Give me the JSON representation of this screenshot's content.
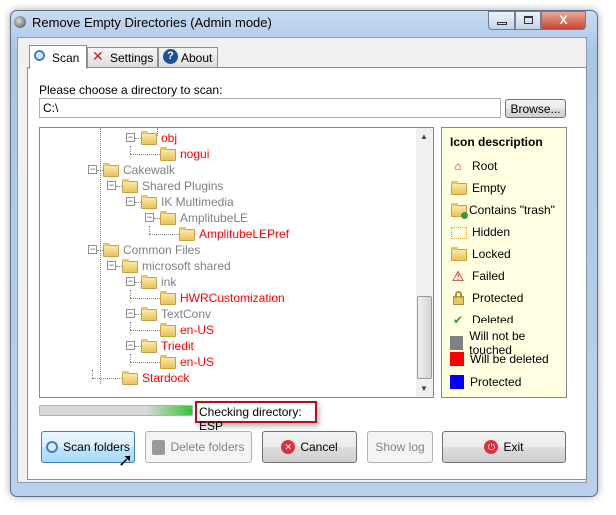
{
  "window": {
    "title": "Remove Empty Directories (Admin mode)",
    "close_label": "X"
  },
  "tabs": [
    {
      "label": "Scan",
      "icon": "magnifier-icon"
    },
    {
      "label": "Settings",
      "icon": "tools-icon"
    },
    {
      "label": "About",
      "icon": "help-icon"
    }
  ],
  "scan": {
    "prompt": "Please choose a directory to scan:",
    "directory": "C:\\",
    "browse_label": "Browse...",
    "status": "Checking directory: ESP",
    "progress_percent": 27
  },
  "tree": [
    {
      "label": "obj",
      "level": 2,
      "color": "red",
      "expanded": true
    },
    {
      "label": "nogui",
      "level": 3,
      "color": "red",
      "expanded": false
    },
    {
      "label": "Cakewalk",
      "level": 0,
      "color": "gray",
      "expanded": true
    },
    {
      "label": "Shared Plugins",
      "level": 1,
      "color": "gray",
      "expanded": true
    },
    {
      "label": "IK Multimedia",
      "level": 2,
      "color": "gray",
      "expanded": true
    },
    {
      "label": "AmplitubeLE",
      "level": 3,
      "color": "gray",
      "expanded": true
    },
    {
      "label": "AmplitubeLEPref",
      "level": 4,
      "color": "red",
      "expanded": false
    },
    {
      "label": "Common Files",
      "level": 0,
      "color": "gray",
      "expanded": true
    },
    {
      "label": "microsoft shared",
      "level": 1,
      "color": "gray",
      "expanded": true
    },
    {
      "label": "ink",
      "level": 2,
      "color": "gray",
      "expanded": true
    },
    {
      "label": "HWRCustomization",
      "level": 3,
      "color": "red",
      "expanded": false
    },
    {
      "label": "TextConv",
      "level": 2,
      "color": "gray",
      "expanded": true
    },
    {
      "label": "en-US",
      "level": 3,
      "color": "red",
      "expanded": false
    },
    {
      "label": "Triedit",
      "level": 2,
      "color": "red",
      "expanded": true
    },
    {
      "label": "en-US",
      "level": 3,
      "color": "red",
      "expanded": false
    },
    {
      "label": "Stardock",
      "level": 1,
      "color": "red",
      "expanded": false
    }
  ],
  "colors": {
    "red": "#ff0000",
    "gray": "#808080",
    "blue": "#0000ff",
    "legend_bg": "#ffffe1"
  },
  "legend": {
    "title": "Icon description",
    "icons": [
      {
        "label": "Root",
        "icon": "house-icon"
      },
      {
        "label": "Empty",
        "icon": "folder-icon"
      },
      {
        "label": "Contains \"trash\"",
        "icon": "folder-trash-icon"
      },
      {
        "label": "Hidden",
        "icon": "hidden-folder-icon"
      },
      {
        "label": "Locked",
        "icon": "locked-folder-icon"
      },
      {
        "label": "Failed",
        "icon": "warning-icon"
      },
      {
        "label": "Protected",
        "icon": "lock-icon"
      },
      {
        "label": "Deleted",
        "icon": "checkmark-icon"
      }
    ],
    "swatches": [
      {
        "label": "Will not be touched",
        "color": "#808080"
      },
      {
        "label": "Will be deleted",
        "color": "#ff0000"
      },
      {
        "label": "Protected",
        "color": "#0000ff"
      }
    ]
  },
  "buttons": {
    "scan": "Scan folders",
    "delete": "Delete folders",
    "cancel": "Cancel",
    "log": "Show log",
    "exit": "Exit"
  }
}
